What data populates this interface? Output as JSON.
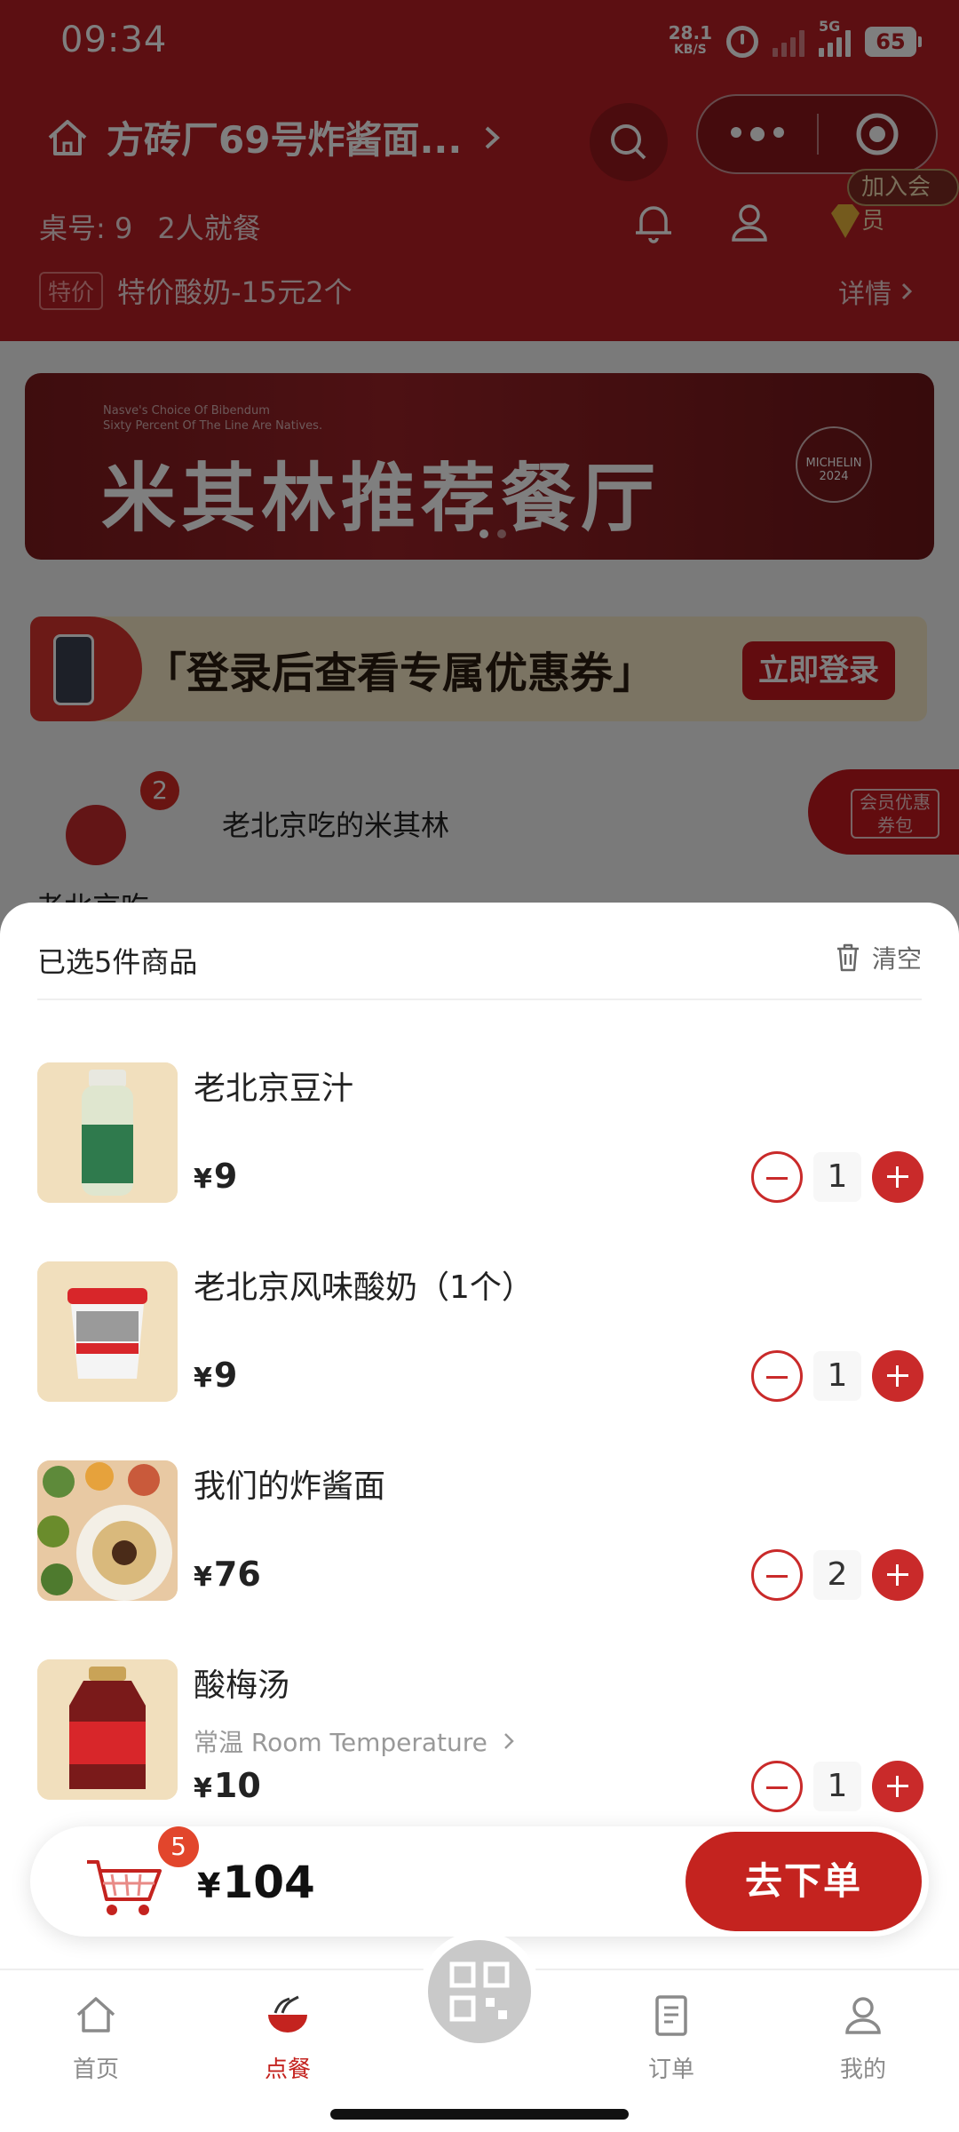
{
  "status_bar": {
    "time": "09:34",
    "net_speed": "28.1",
    "net_unit": "KB/S",
    "network": "5G",
    "battery": "65"
  },
  "header": {
    "store_name": "方砖厂69号炸酱面...",
    "member_badge": "加入会员",
    "table_label": "桌号: 9",
    "diners": "2人就餐",
    "promo_tag": "特价",
    "promo_text": "特价酸奶-15元2个",
    "details": "详情"
  },
  "banner": {
    "line1": "Nasve's Choice Of Bibendum",
    "line2": "Sixty Percent Of The Line Are Natives.",
    "title": "米其林推荐餐厅",
    "seal_text": "MICHELIN",
    "seal_year": "2024"
  },
  "login_strip": {
    "text": "「登录后查看专属优惠券」",
    "button": "立即登录"
  },
  "category": {
    "badge": "2",
    "name": "老北京吃的米其林",
    "left_label": "老北京吃",
    "coupon_pack": "会员优惠券包"
  },
  "cart": {
    "title": "已选5件商品",
    "clear": "清空",
    "items": [
      {
        "name": "老北京豆汁",
        "spec": "",
        "price": "9",
        "qty": "1"
      },
      {
        "name": "老北京风味酸奶（1个）",
        "spec": "",
        "price": "9",
        "qty": "1"
      },
      {
        "name": "我们的炸酱面",
        "spec": "",
        "price": "76",
        "qty": "2"
      },
      {
        "name": "酸梅汤",
        "spec": "常温 Room Temperature",
        "price": "10",
        "qty": "1"
      }
    ]
  },
  "checkout": {
    "count": "5",
    "currency": "¥",
    "total": "104",
    "button": "去下单"
  },
  "tabs": [
    {
      "label": "首页"
    },
    {
      "label": "点餐"
    },
    {
      "label": "订单"
    },
    {
      "label": "我的"
    }
  ],
  "colors": {
    "brand_red": "#c4231f",
    "header_red": "#b81e24"
  }
}
